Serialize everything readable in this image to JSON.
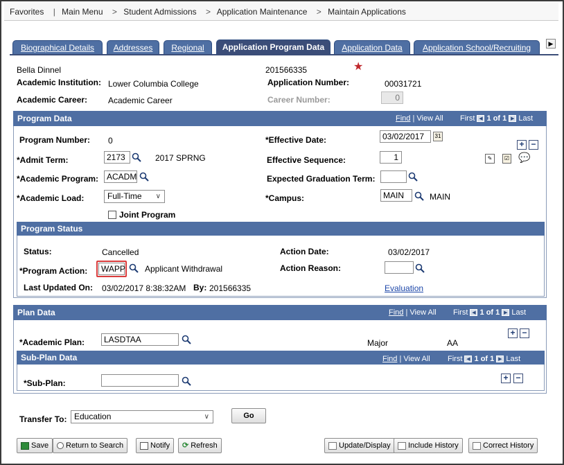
{
  "breadcrumb": {
    "favorites": "Favorites",
    "main_menu": "Main Menu",
    "sep": ">",
    "items": [
      "Student Admissions",
      "Application Maintenance",
      "Maintain Applications"
    ]
  },
  "tabs": [
    {
      "label": "Biographical Details"
    },
    {
      "label": "Addresses"
    },
    {
      "label": "Regional"
    },
    {
      "label": "Application Program Data"
    },
    {
      "label": "Application Data"
    },
    {
      "label": "Application School/Recruiting"
    }
  ],
  "tab_scroll_icon": "right-arrow-icon",
  "header": {
    "name": "Bella Dinnel",
    "id": "201566335",
    "star": "★",
    "institution_label": "Academic Institution:",
    "institution_value": "Lower Columbia College",
    "app_number_label": "Application Number:",
    "app_number_value": "00031721",
    "career_label": "Academic Career:",
    "career_value": "Academic Career",
    "career_number_label": "Career Number:",
    "career_number_value": "0"
  },
  "program_data": {
    "title": "Program Data",
    "nav": {
      "find": "Find",
      "view_all": "View All",
      "first": "First",
      "count": "1 of 1",
      "last": "Last"
    },
    "program_number_label": "Program Number:",
    "program_number_value": "0",
    "effective_date_label": "*Effective Date:",
    "effective_date_value": "03/02/2017",
    "admit_term_label": "*Admit Term:",
    "admit_term_value": "2173",
    "admit_term_desc": "2017 SPRNG",
    "effective_seq_label": "Effective Sequence:",
    "effective_seq_value": "1",
    "academic_program_label": "*Academic Program:",
    "academic_program_value": "ACADM",
    "expected_grad_label": "Expected Graduation Term:",
    "expected_grad_value": "",
    "academic_load_label": "*Academic Load:",
    "academic_load_value": "Full-Time",
    "campus_label": "*Campus:",
    "campus_value": "MAIN",
    "campus_desc": "MAIN",
    "joint_program_label": "Joint Program"
  },
  "program_status": {
    "title": "Program Status",
    "status_label": "Status:",
    "status_value": "Cancelled",
    "action_date_label": "Action Date:",
    "action_date_value": "03/02/2017",
    "program_action_label": "*Program Action:",
    "program_action_value": "WAPP",
    "program_action_desc": "Applicant Withdrawal",
    "action_reason_label": "Action Reason:",
    "action_reason_value": "",
    "last_updated_label": "Last Updated On:",
    "last_updated_value": "03/02/2017  8:38:32AM",
    "by_label": "By:",
    "by_value": "201566335",
    "evaluation_link": "Evaluation"
  },
  "plan_data": {
    "title": "Plan Data",
    "nav": {
      "find": "Find",
      "view_all": "View All",
      "first": "First",
      "count": "1 of 1",
      "last": "Last"
    },
    "academic_plan_label": "*Academic Plan:",
    "academic_plan_value": "LASDTAA",
    "plan_type": "Major",
    "plan_degree": "AA"
  },
  "subplan_data": {
    "title": "Sub-Plan Data",
    "nav": {
      "find": "Find",
      "view_all": "View All",
      "first": "First",
      "count": "1 of 1",
      "last": "Last"
    },
    "sub_plan_label": "*Sub-Plan:",
    "sub_plan_value": ""
  },
  "transfer": {
    "label": "Transfer To:",
    "value": "Education",
    "go_label": "Go"
  },
  "toolbar": {
    "save": "Save",
    "return_to_search": "Return to Search",
    "notify": "Notify",
    "refresh": "Refresh",
    "update_display": "Update/Display",
    "include_history": "Include History",
    "correct_history": "Correct History"
  },
  "colors": {
    "header_blue": "#4f6fa3",
    "active_tab": "#3b4d78",
    "highlight_red": "#d93b3b",
    "link_blue": "#1c46a8",
    "star_red": "#c0282d"
  }
}
